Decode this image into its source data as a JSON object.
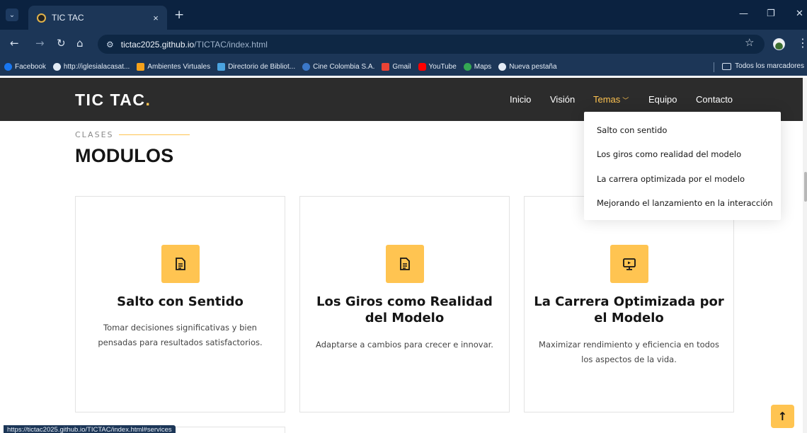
{
  "browser": {
    "tab_title": "TIC TAC",
    "tab_close": "×",
    "new_tab": "+",
    "url_host": "tictac2025.github.io",
    "url_path": "/TICTAC/index.html",
    "status_url": "https://tictac2025.github.io/TICTAC/index.html#services",
    "bookmarks": [
      {
        "label": "Facebook",
        "icon": "facebook-icon",
        "color": "#1877f2"
      },
      {
        "label": "http://iglesialacasat...",
        "icon": "globe-icon",
        "color": "#e3ebf5"
      },
      {
        "label": "Ambientes Virtuales",
        "icon": "moodle-icon",
        "color": "#f5a21b"
      },
      {
        "label": "Directorio de Bibliot...",
        "icon": "library-icon",
        "color": "#4aa3df"
      },
      {
        "label": "Cine Colombia S.A.",
        "icon": "cine-icon",
        "color": "#3b78c9"
      },
      {
        "label": "Gmail",
        "icon": "gmail-icon",
        "color": "#ea4335"
      },
      {
        "label": "YouTube",
        "icon": "youtube-icon",
        "color": "#ff0000"
      },
      {
        "label": "Maps",
        "icon": "maps-icon",
        "color": "#34a853"
      },
      {
        "label": "Nueva pestaña",
        "icon": "globe-icon",
        "color": "#e3ebf5"
      }
    ],
    "all_bookmarks": "Todos los marcadores"
  },
  "site": {
    "logo": "TIC TAC",
    "logo_dot": ".",
    "nav": {
      "inicio": "Inicio",
      "vision": "Visión",
      "temas": "Temas",
      "equipo": "Equipo",
      "contacto": "Contacto"
    },
    "dropdown": [
      "Salto con sentido",
      "Los giros como realidad del modelo",
      "La carrera optimizada por el modelo",
      "Mejorando el lanzamiento en la interacción"
    ],
    "section": {
      "eyebrow": "CLASES",
      "title": "MODULOS"
    },
    "cards": [
      {
        "icon": "document-icon",
        "title": "Salto con Sentido",
        "text": "Tomar decisiones significativas y bien pensadas para resultados satisfactorios."
      },
      {
        "icon": "document-icon",
        "title": "Los Giros como Realidad del Modelo",
        "text": "Adaptarse a cambios para crecer e innovar."
      },
      {
        "icon": "presentation-icon",
        "title": "La Carrera Optimizada por el Modelo",
        "text": "Maximizar rendimiento y eficiencia en todos los aspectos de la vida."
      }
    ]
  },
  "colors": {
    "accent": "#ffc451",
    "header_bg": "#2c2c2c",
    "chrome_bg": "#1c3657"
  }
}
